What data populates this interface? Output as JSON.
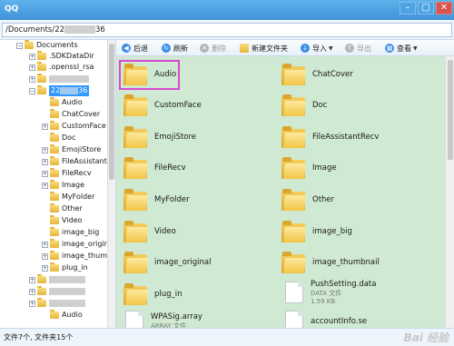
{
  "window": {
    "title": "QQ",
    "controls": [
      "–",
      "□",
      "✕"
    ]
  },
  "path": {
    "prefix": "/Documents/22",
    "suffix": "36"
  },
  "tree": {
    "items": [
      {
        "label": "Documents",
        "expander": "−"
      },
      {
        "label": ".SDKDataDir",
        "expander": "+"
      },
      {
        "label": ".openssl_rsa",
        "expander": "+"
      },
      {
        "label": "",
        "expander": "+"
      },
      {
        "label": "22",
        "label_suffix": "36",
        "expander": "−"
      },
      {
        "label": "Audio",
        "expander": ""
      },
      {
        "label": "ChatCover",
        "expander": ""
      },
      {
        "label": "CustomFace",
        "expander": "+"
      },
      {
        "label": "Doc",
        "expander": ""
      },
      {
        "label": "EmojiStore",
        "expander": "+"
      },
      {
        "label": "FileAssistantI",
        "expander": "+"
      },
      {
        "label": "FileRecv",
        "expander": "+"
      },
      {
        "label": "Image",
        "expander": "+"
      },
      {
        "label": "MyFolder",
        "expander": ""
      },
      {
        "label": "Other",
        "expander": ""
      },
      {
        "label": "Video",
        "expander": ""
      },
      {
        "label": "image_big",
        "expander": ""
      },
      {
        "label": "image_origir",
        "expander": "+"
      },
      {
        "label": "image_thumb",
        "expander": "+"
      },
      {
        "label": "plug_in",
        "expander": "+"
      },
      {
        "label": "",
        "expander": "+"
      },
      {
        "label": "",
        "expander": "+"
      },
      {
        "label": "",
        "expander": "+"
      },
      {
        "label": "Audio",
        "expander": ""
      }
    ]
  },
  "toolbar": {
    "back": "后退",
    "refresh": "刷新",
    "delete": "删除",
    "new_folder": "新建文件夹",
    "import": "导入",
    "export": "导出",
    "view": "查看"
  },
  "files": {
    "folders": [
      "Audio",
      "ChatCover",
      "CustomFace",
      "Doc",
      "EmojiStore",
      "FileAssistantRecv",
      "FileRecv",
      "Image",
      "MyFolder",
      "Other",
      "Video",
      "image_big",
      "image_original",
      "image_thumbnail",
      "plug_in"
    ],
    "file1": {
      "name": "PushSetting.data",
      "type": "DATA 文件",
      "size": "1.59 KB"
    },
    "file2": {
      "name": "WPASig.array",
      "type": "ARRAY 文件"
    },
    "file3": {
      "name": "accountInfo.se",
      "type": ""
    }
  },
  "status": {
    "text": "文件7个, 文件夹15个"
  },
  "watermark": "Bai 经验",
  "colors": {
    "content_bg": "#cfe9d2",
    "selection": "#3399ff",
    "highlight_border": "#d84ad0",
    "titlebar": "#3f93d8"
  }
}
